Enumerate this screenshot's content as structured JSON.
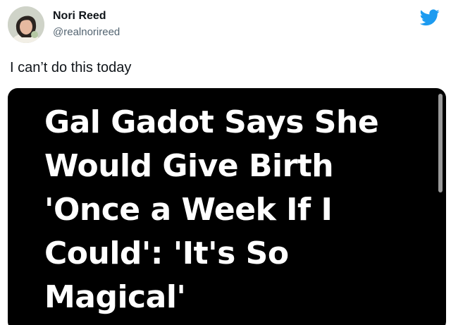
{
  "author": {
    "display_name": "Nori Reed",
    "handle": "@realnorireed",
    "avatar_icon": "user-avatar"
  },
  "brand": {
    "icon": "twitter-bird-icon",
    "color": "#1d9bf0"
  },
  "tweet": {
    "text": "I can’t do this today"
  },
  "media": {
    "headline": "Gal Gadot Says She Would Give Birth 'Once a Week If I Could': 'It's So Magical'",
    "background": "#000000"
  }
}
